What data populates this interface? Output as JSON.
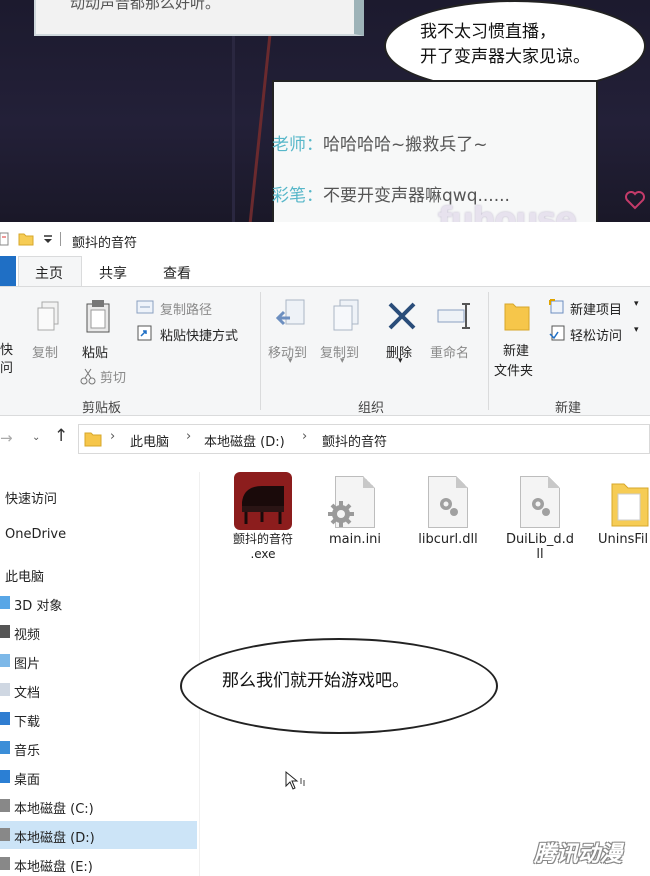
{
  "top_panel": {
    "caption": "动动声音都那么好听。",
    "bubble_lines": [
      "我不太习惯直播，",
      "开了变声器大家见谅。"
    ],
    "chat": [
      {
        "name": "老师",
        "message": "哈哈哈哈~搬救兵了~"
      },
      {
        "name": "彩笔",
        "message": "不要开变声器嘛qwq......"
      }
    ],
    "watermark": "fuhouse"
  },
  "explorer": {
    "window_title": "颤抖的音符",
    "tabs": [
      "主页",
      "共享",
      "查看"
    ],
    "ribbon": {
      "clipboard": {
        "items": [
          "快",
          "问",
          "复制",
          "粘贴",
          "复制路径",
          "粘贴快捷方式",
          "剪切"
        ],
        "group_label": "剪贴板"
      },
      "organize": {
        "items": [
          "移动到",
          "复制到",
          "删除",
          "重命名"
        ],
        "group_label": "组织"
      },
      "new": {
        "items": [
          "新建",
          "文件夹",
          "新建项目",
          "轻松访问"
        ],
        "group_label": "新建"
      }
    },
    "address": {
      "crumbs": [
        "此电脑",
        "本地磁盘 (D:)",
        "颤抖的音符"
      ]
    },
    "nav": [
      "快速访问",
      "OneDrive",
      "此电脑",
      "3D 对象",
      "视频",
      "图片",
      "文档",
      "下载",
      "音乐",
      "桌面",
      "本地磁盘 (C:)",
      "本地磁盘 (D:)",
      "本地磁盘 (E:)"
    ],
    "files": [
      {
        "name_line1": "颤抖的音符",
        "name_line2": ".exe"
      },
      {
        "name_line1": "main.ini",
        "name_line2": ""
      },
      {
        "name_line1": "libcurl.dll",
        "name_line2": ""
      },
      {
        "name_line1": "DuiLib_d.d",
        "name_line2": "ll"
      },
      {
        "name_line1": "UninsFil",
        "name_line2": ""
      }
    ]
  },
  "bottom_bubble": "那么我们就开始游戏吧。",
  "corner_watermark": "腾讯动漫",
  "colors": {
    "accent": "#1f6fc5",
    "chat_name": "#57b7c9",
    "selected": "#cce4f7"
  }
}
